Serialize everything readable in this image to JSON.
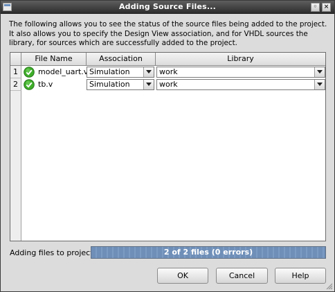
{
  "window": {
    "title": "Adding Source Files...",
    "controls": [
      "◦",
      "×"
    ]
  },
  "description": "The following allows you to see the status of the source files being added to the project.  It also allows you to specify the Design View association, and for VHDL sources the library, for sources which are successfully added to the project.",
  "table": {
    "columns": [
      "File Name",
      "Association",
      "Library"
    ],
    "rows": [
      {
        "num": "1",
        "status_icon": "check-icon",
        "file": "model_uart.v",
        "association": "Simulation",
        "library": "work"
      },
      {
        "num": "2",
        "status_icon": "check-icon",
        "file": "tb.v",
        "association": "Simulation",
        "library": "work"
      }
    ]
  },
  "progress": {
    "label": "Adding files to project:",
    "text": "2 of 2 files (0 errors)",
    "fraction": 1.0
  },
  "buttons": {
    "ok": "OK",
    "cancel": "Cancel",
    "help": "Help"
  },
  "colors": {
    "titlebar": "#2d2d2d",
    "progress_fill": "#6f8fb8",
    "check_green": "#3fae2a"
  }
}
